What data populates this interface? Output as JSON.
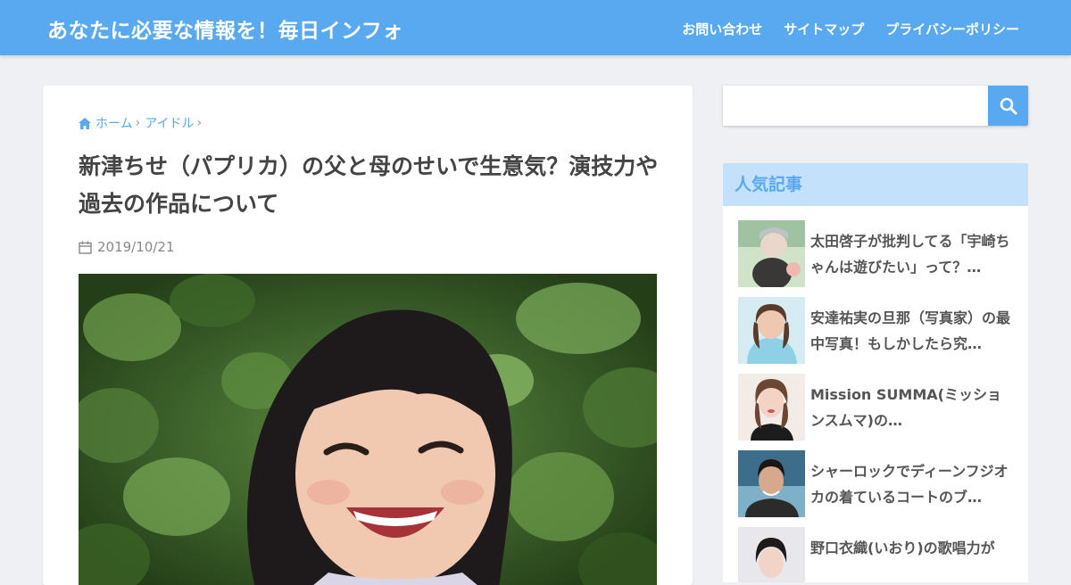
{
  "header": {
    "site_title": "あなたに必要な情報を！毎日インフォ",
    "nav": [
      "お問い合わせ",
      "サイトマップ",
      "プライバシーポリシー"
    ]
  },
  "article": {
    "breadcrumb": {
      "home": "ホーム",
      "category": "アイドル",
      "home_icon": "home-icon"
    },
    "title": "新津ちせ（パプリカ）の父と母のせいで生意気？演技力や過去の作品について",
    "date": "2019/10/21",
    "date_icon": "calendar-icon"
  },
  "sidebar": {
    "search": {
      "placeholder": "",
      "value": "",
      "icon": "search-icon"
    },
    "popular": {
      "title": "人気記事",
      "items": [
        {
          "text": "太田啓子が批判してる「宇崎ちゃんは遊びたい」って？…"
        },
        {
          "text": "安達祐実の旦那（写真家）の最中写真！もしかしたら究…"
        },
        {
          "text": "Mission SUMMA(ミッションスムマ)の…"
        },
        {
          "text": "シャーロックでディーンフジオカの着ているコートのブ…"
        },
        {
          "text": "野口衣織(いおり)の歌唱力が"
        }
      ]
    }
  },
  "colors": {
    "accent": "#58a9ef",
    "widget_header_bg": "#c4e1fc",
    "background": "#eef0f3"
  }
}
